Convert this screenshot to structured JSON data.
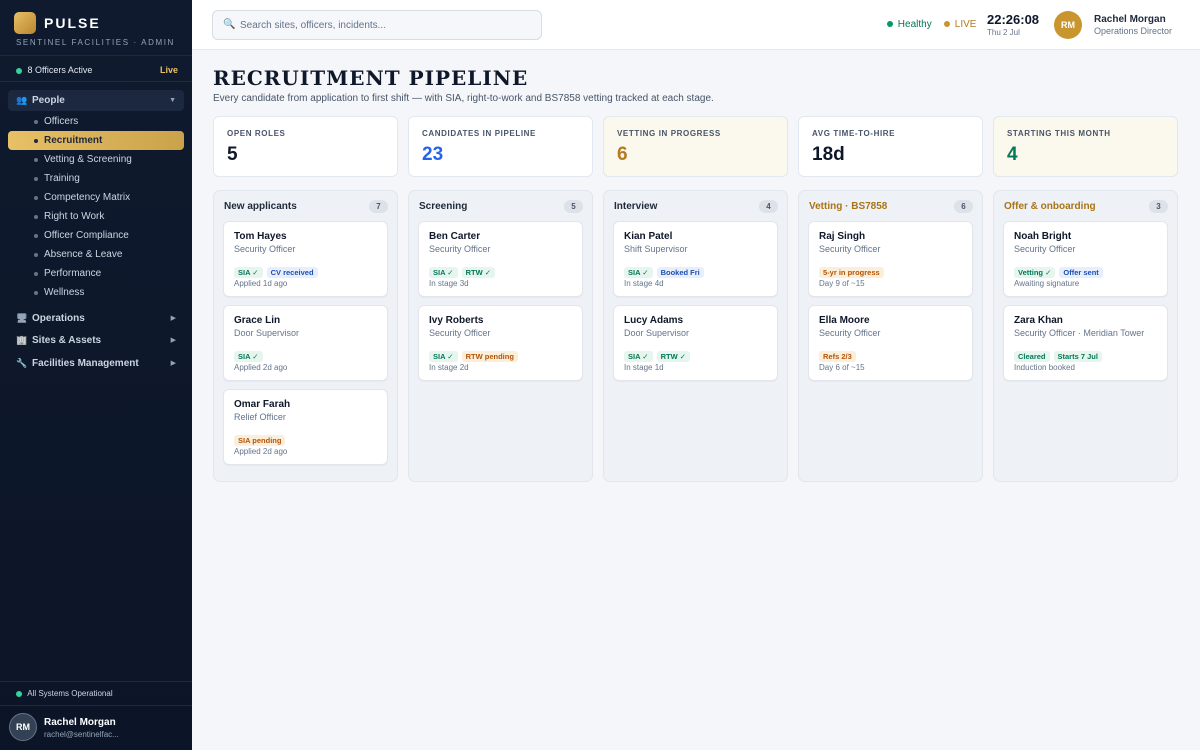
{
  "brand": {
    "name": "PULSE",
    "subtitle": "SENTINEL FACILITIES · ADMIN"
  },
  "sidebar": {
    "officers_active": "8 Officers Active",
    "live_label": "Live",
    "sections": [
      {
        "label": "People",
        "icon": "people-icon"
      },
      {
        "label": "Operations",
        "icon": "monitor-icon"
      },
      {
        "label": "Sites & Assets",
        "icon": "building-icon"
      },
      {
        "label": "Facilities Management",
        "icon": "wrench-icon"
      }
    ],
    "people_items": [
      "Officers",
      "Recruitment",
      "Vetting & Screening",
      "Training",
      "Competency Matrix",
      "Right to Work",
      "Officer Compliance",
      "Absence & Leave",
      "Performance",
      "Wellness"
    ],
    "active_item": "Recruitment",
    "system_status": "All Systems Operational",
    "user": {
      "initials": "RM",
      "name": "Rachel Morgan",
      "email": "rachel@sentinelfac..."
    }
  },
  "topbar": {
    "search_placeholder": "Search sites, officers, incidents...",
    "health": "Healthy",
    "live": "LIVE",
    "time": "22:26:08",
    "date": "Thu 2 Jul",
    "user": {
      "initials": "RM",
      "name": "Rachel Morgan",
      "role": "Operations Director"
    }
  },
  "page": {
    "title": "RECRUITMENT PIPELINE",
    "subtitle": "Every candidate from application to first shift — with SIA, right-to-work and BS7858 vetting tracked at each stage."
  },
  "kpis": [
    {
      "label": "OPEN ROLES",
      "value": "5",
      "color": "#0f172a"
    },
    {
      "label": "CANDIDATES IN PIPELINE",
      "value": "23",
      "color": "#2563eb"
    },
    {
      "label": "VETTING IN PROGRESS",
      "value": "6",
      "color": "#b7791f"
    },
    {
      "label": "AVG TIME-TO-HIRE",
      "value": "18d",
      "color": "#0f172a"
    },
    {
      "label": "STARTING THIS MONTH",
      "value": "4",
      "color": "#047857"
    }
  ],
  "columns": [
    {
      "title": "New applicants",
      "count": "7",
      "cards": [
        {
          "name": "Tom Hayes",
          "role": "Security Officer",
          "tags": [
            {
              "text": "SIA ✓",
              "tone": "green"
            },
            {
              "text": "CV received",
              "tone": "blue"
            }
          ],
          "foot": "Applied 1d ago"
        },
        {
          "name": "Grace Lin",
          "role": "Door Supervisor",
          "tags": [
            {
              "text": "SIA ✓",
              "tone": "green"
            }
          ],
          "foot": "Applied 2d ago"
        },
        {
          "name": "Omar Farah",
          "role": "Relief Officer",
          "tags": [
            {
              "text": "SIA pending",
              "tone": "amber"
            }
          ],
          "foot": "Applied 2d ago"
        }
      ]
    },
    {
      "title": "Screening",
      "count": "5",
      "cards": [
        {
          "name": "Ben Carter",
          "role": "Security Officer",
          "tags": [
            {
              "text": "SIA ✓",
              "tone": "green"
            },
            {
              "text": "RTW ✓",
              "tone": "green"
            }
          ],
          "foot": "In stage 3d"
        },
        {
          "name": "Ivy Roberts",
          "role": "Security Officer",
          "tags": [
            {
              "text": "SIA ✓",
              "tone": "green"
            },
            {
              "text": "RTW pending",
              "tone": "amber"
            }
          ],
          "foot": "In stage 2d"
        }
      ]
    },
    {
      "title": "Interview",
      "count": "4",
      "cards": [
        {
          "name": "Kian Patel",
          "role": "Shift Supervisor",
          "tags": [
            {
              "text": "SIA ✓",
              "tone": "green"
            },
            {
              "text": "Booked Fri",
              "tone": "blue"
            }
          ],
          "foot": "In stage 4d"
        },
        {
          "name": "Lucy Adams",
          "role": "Door Supervisor",
          "tags": [
            {
              "text": "SIA ✓",
              "tone": "green"
            },
            {
              "text": "RTW ✓",
              "tone": "green"
            }
          ],
          "foot": "In stage 1d"
        }
      ]
    },
    {
      "title": "Vetting · BS7858",
      "count": "6",
      "cards": [
        {
          "name": "Raj Singh",
          "role": "Security Officer",
          "tags": [
            {
              "text": "5-yr in progress",
              "tone": "amber"
            }
          ],
          "foot": "Day 9 of ~15"
        },
        {
          "name": "Ella Moore",
          "role": "Security Officer",
          "tags": [
            {
              "text": "Refs 2/3",
              "tone": "amber"
            }
          ],
          "foot": "Day 6 of ~15"
        }
      ]
    },
    {
      "title": "Offer & onboarding",
      "count": "3",
      "cards": [
        {
          "name": "Noah Bright",
          "role": "Security Officer",
          "tags": [
            {
              "text": "Vetting ✓",
              "tone": "green"
            },
            {
              "text": "Offer sent",
              "tone": "blue"
            }
          ],
          "foot": "Awaiting signature"
        },
        {
          "name": "Zara Khan",
          "role": "Security Officer · Meridian Tower",
          "tags": [
            {
              "text": "Cleared",
              "tone": "green"
            },
            {
              "text": "Starts 7 Jul",
              "tone": "green"
            }
          ],
          "foot": "Induction booked"
        }
      ]
    }
  ]
}
